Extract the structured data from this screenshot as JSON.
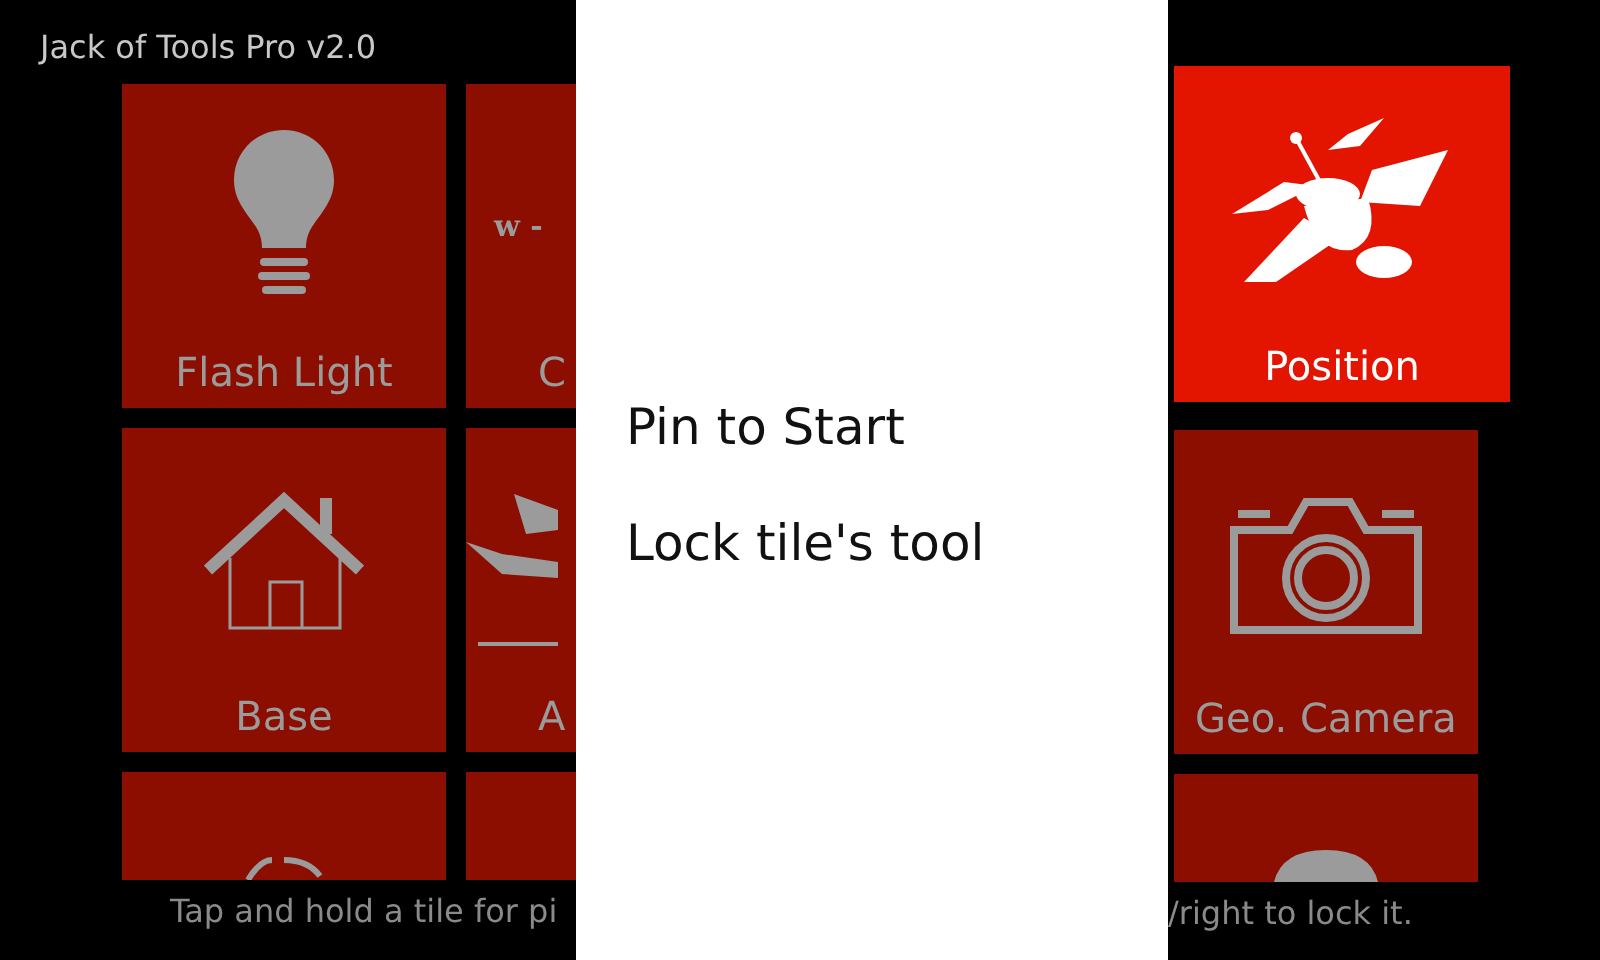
{
  "app_title": "Jack of Tools Pro v2.0",
  "tile_columns": [
    [
      {
        "label": "Flash Light",
        "selected": false
      },
      {
        "label": "Base",
        "selected": false
      },
      {
        "selected": false
      }
    ],
    [
      {
        "label": "C",
        "icon_text": "w -",
        "selected": false
      },
      {
        "label": "A",
        "selected": false
      },
      {
        "selected": false
      }
    ],
    [
      {
        "label": "Position",
        "selected": true
      },
      {
        "label": "Geo. Camera",
        "selected": false
      },
      {
        "selected": false
      }
    ]
  ],
  "context_menu": [
    {
      "label": "Pin to Start"
    },
    {
      "label": "Lock tile's tool"
    }
  ],
  "hint": [
    "Tap and hold a tile for pi",
    "/right to lock it."
  ]
}
